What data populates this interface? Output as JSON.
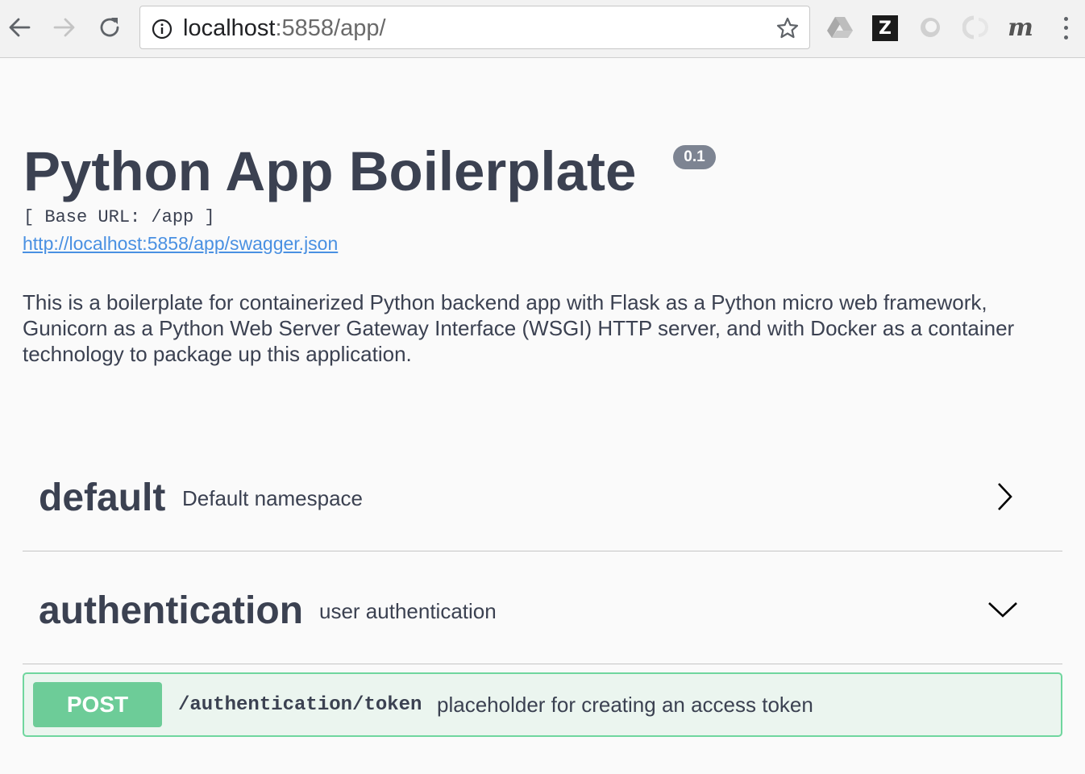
{
  "browser": {
    "url_host": "localhost",
    "url_rest": ":5858/app/",
    "icons": {
      "back": "arrow-left-icon",
      "forward": "arrow-right-icon",
      "reload": "reload-icon",
      "info": "info-icon",
      "bookmark": "star-icon",
      "drive": "google-drive-icon",
      "zotero": "zotero-icon",
      "ext_ring": "ring-extension-icon",
      "ext_ring_faded": "faded-ring-extension-icon",
      "ext_m": "m-extension-icon",
      "menu": "more-vertical-icon"
    },
    "zotero_letter": "Z",
    "ext_m_letter": "m"
  },
  "info": {
    "title": "Python App Boilerplate",
    "version": "0.1",
    "base_url": "[ Base URL: /app ]",
    "spec_link": "http://localhost:5858/app/swagger.json",
    "description": "This is a boilerplate for containerized Python backend app with Flask as a Python micro web framework, Gunicorn as a Python Web Server Gateway Interface (WSGI) HTTP server, and with Docker as a container technology to package up this application."
  },
  "tags": [
    {
      "name": "default",
      "description": "Default namespace",
      "expanded": false
    },
    {
      "name": "authentication",
      "description": "user authentication",
      "expanded": true
    }
  ],
  "operations": [
    {
      "method": "POST",
      "path": "/authentication/token",
      "summary": "placeholder for creating an access token"
    }
  ],
  "colors": {
    "post_method": "#6dcc98",
    "post_border": "#6fd69e",
    "post_background": "#ebf5ef",
    "link": "#4990e2",
    "text": "#3b4151",
    "version_badge": "#7d8492"
  }
}
